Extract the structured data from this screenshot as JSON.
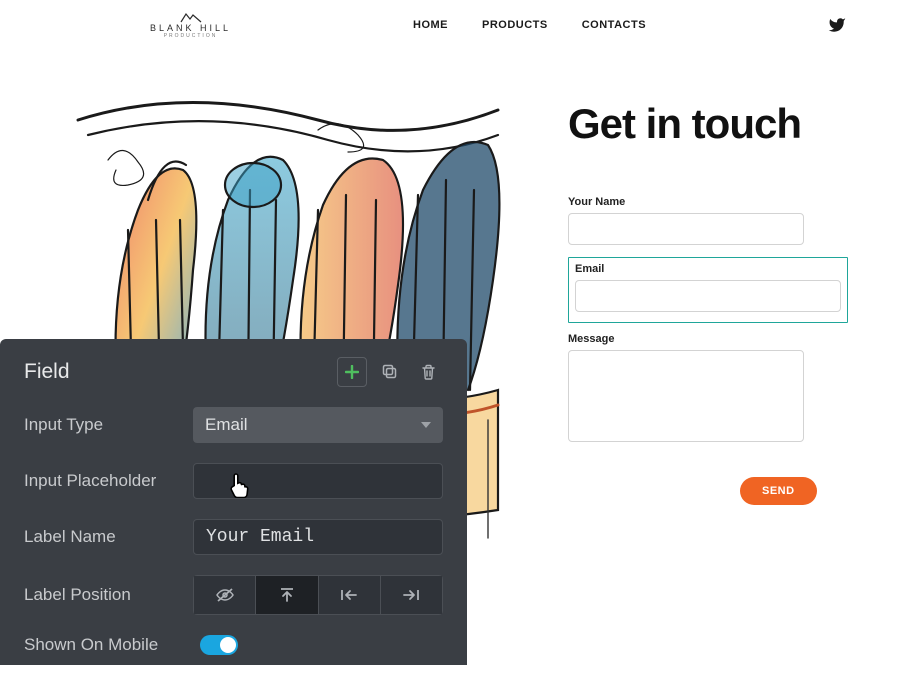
{
  "header": {
    "logo_line1": "BLANK HILL",
    "logo_line2": "PRODUCTION",
    "nav": [
      "HOME",
      "PRODUCTS",
      "CONTACTS"
    ]
  },
  "contact": {
    "title": "Get in touch",
    "fields": {
      "name_label": "Your Name",
      "email_label": "Email",
      "message_label": "Message"
    },
    "send_label": "SEND"
  },
  "editor": {
    "panel_title": "Field",
    "rows": {
      "input_type": {
        "label": "Input Type",
        "value": "Email"
      },
      "placeholder": {
        "label": "Input Placeholder",
        "value": ""
      },
      "label_name": {
        "label": "Label Name",
        "value": "Your Email"
      },
      "label_position": {
        "label": "Label Position"
      },
      "shown_mobile": {
        "label": "Shown On Mobile",
        "value": true
      }
    }
  }
}
